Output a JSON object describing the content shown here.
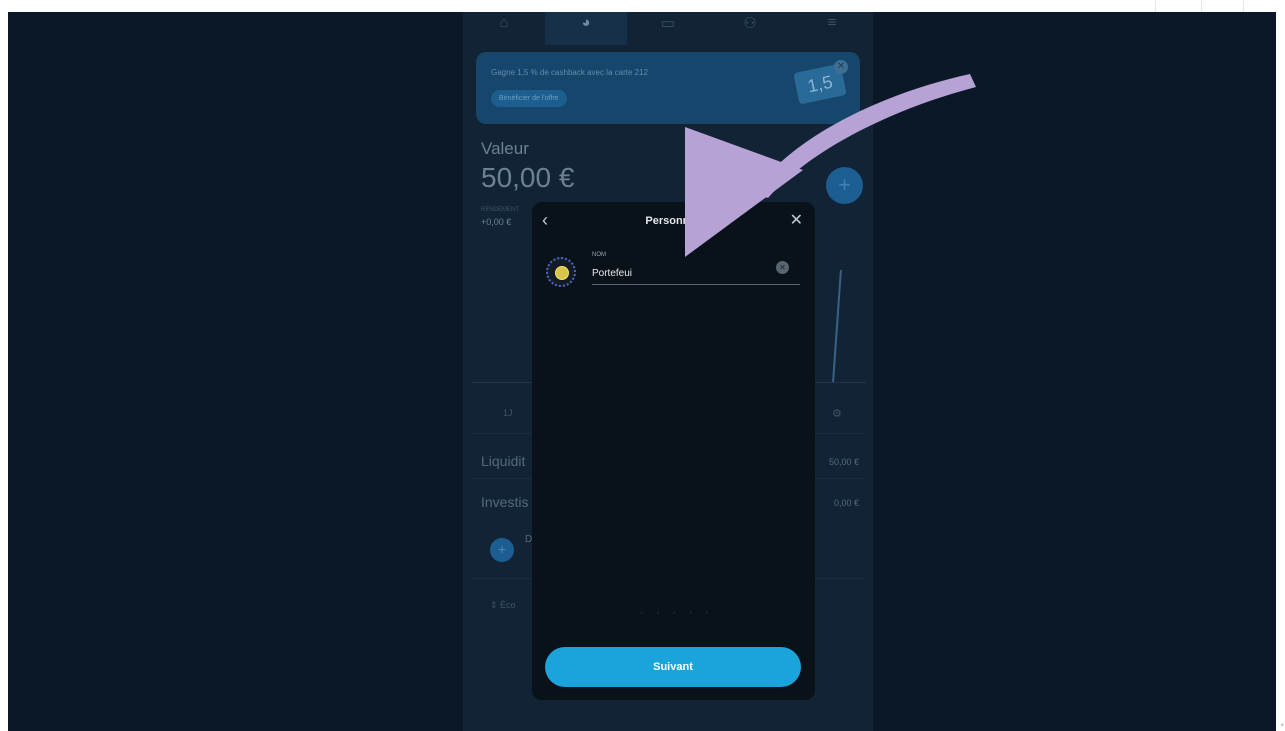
{
  "nav": {
    "items": [
      {
        "icon": "home-icon",
        "glyph": "⌂"
      },
      {
        "icon": "pie-chart-icon",
        "glyph": "◕"
      },
      {
        "icon": "card-icon",
        "glyph": "▭"
      },
      {
        "icon": "community-icon",
        "glyph": "⚇"
      },
      {
        "icon": "menu-icon",
        "glyph": "≡"
      }
    ]
  },
  "promo": {
    "text": "Gagne 1,5 % de cashback avec la carte 212",
    "button": "Bénéficier de l'offre",
    "card_text": "1,5"
  },
  "portfolio": {
    "title": "Valeur",
    "amount": "50,00 €",
    "rendement_label": "RENDEMENT",
    "rendement_value": "+0,00 €"
  },
  "rows": {
    "liquidites_label": "Liquidit",
    "liquidites_value": "50,00 €",
    "investis_label": "Investis",
    "investis_value": "0,00 €",
    "add_letter": "D",
    "bottom_label": "Éco",
    "range_label": "1J"
  },
  "modal": {
    "title": "Personnali",
    "field_label": "NOM",
    "field_value": "Portefeui",
    "submit_label": "Suivant"
  },
  "colors": {
    "accent": "#1ba3dc",
    "annotation_arrow": "#b7a2d6",
    "backdrop": "#0b1828"
  }
}
